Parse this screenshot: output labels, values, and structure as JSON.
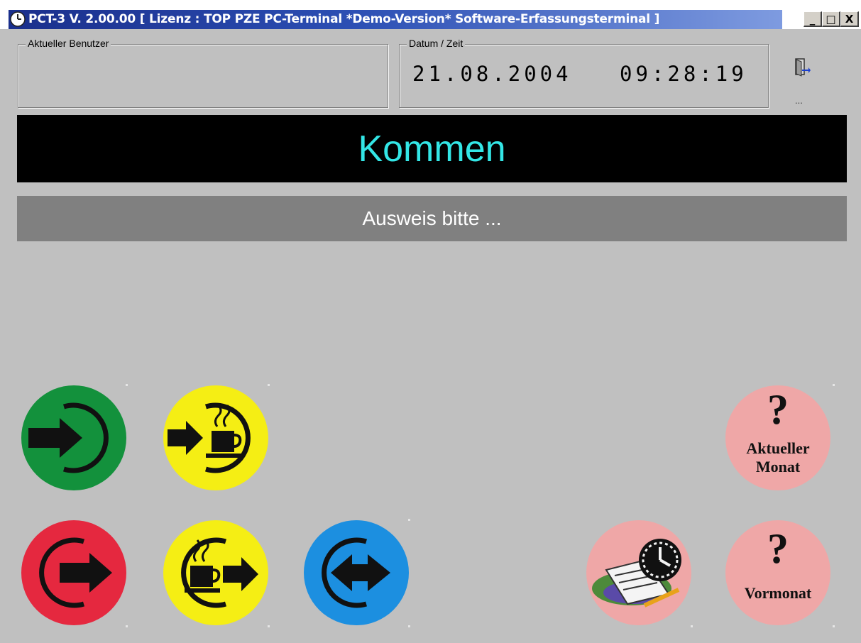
{
  "window": {
    "title": "PCT-3  V. 2.00.00  [ Lizenz : TOP PZE PC-Terminal *Demo-Version* Software-Erfassungsterminal ]",
    "minimize_glyph": "_",
    "maximize_glyph": "□",
    "close_glyph": "X"
  },
  "user_group": {
    "label": "Aktueller Benutzer",
    "value": ""
  },
  "datetime_group": {
    "label": "Datum / Zeit",
    "date": "21.08.2004",
    "time": "09:28:19"
  },
  "exit": {
    "icon": "exit-door-icon",
    "dots": "..."
  },
  "status": {
    "mode": "Kommen",
    "prompt": "Ausweis bitte ...",
    "mode_color": "#33e6e6"
  },
  "buttons": {
    "kommen": {
      "icon": "arrow-in-icon",
      "color": "#13913c"
    },
    "pause_begin": {
      "icon": "coffee-in-icon",
      "color": "#f5ee14"
    },
    "gehen": {
      "icon": "arrow-out-icon",
      "color": "#e5283f"
    },
    "pause_end": {
      "icon": "coffee-out-icon",
      "color": "#f5ee14"
    },
    "dienstgang": {
      "icon": "double-arrow-icon",
      "color": "#1c8fe0"
    },
    "notes": {
      "icon": "notebook-icon",
      "color": "#efa7a7"
    },
    "current_month": {
      "icon": "question-icon",
      "line1": "Aktueller",
      "line2": "Monat",
      "color": "#efa7a7"
    },
    "previous_month": {
      "icon": "question-icon",
      "label": "Vormonat",
      "color": "#efa7a7"
    }
  }
}
